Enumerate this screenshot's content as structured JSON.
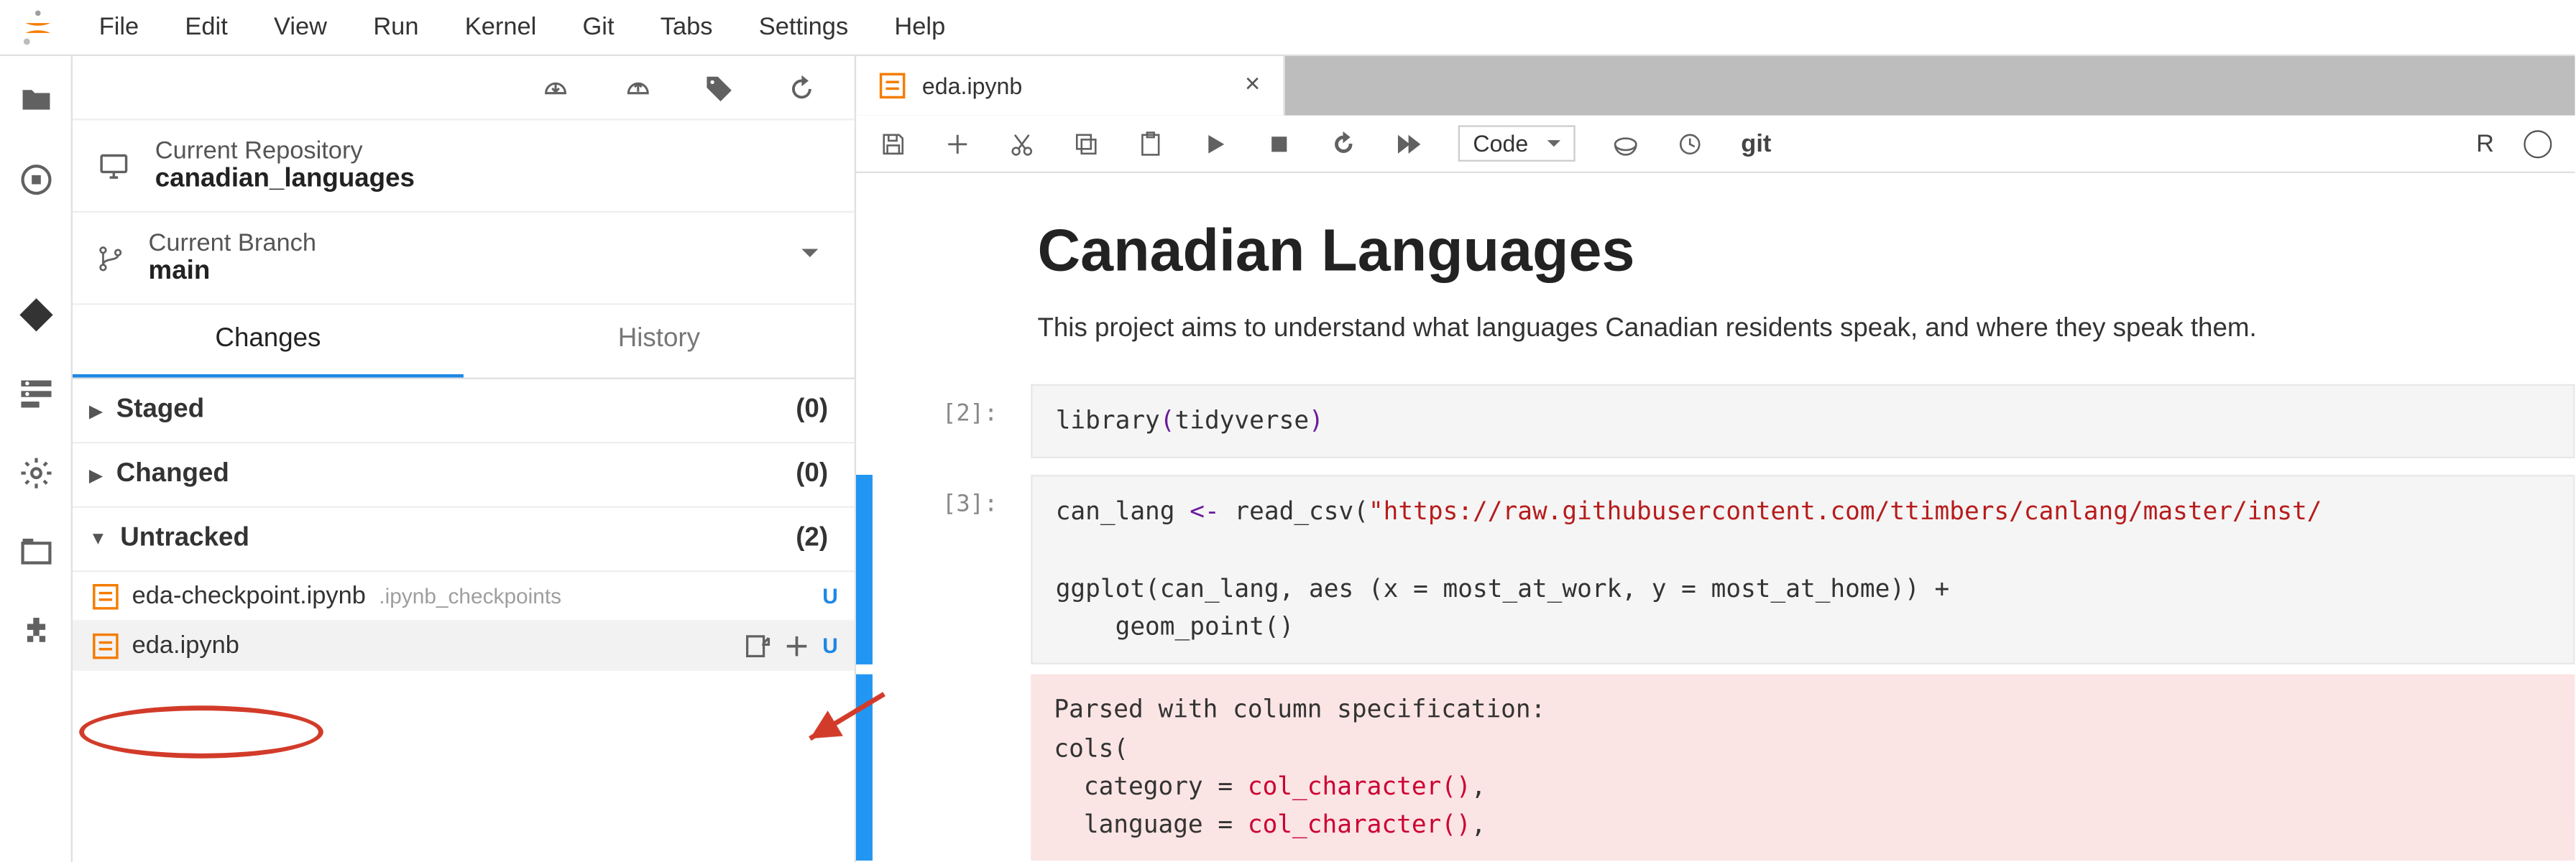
{
  "menu": {
    "items": [
      "File",
      "Edit",
      "View",
      "Run",
      "Kernel",
      "Git",
      "Tabs",
      "Settings",
      "Help"
    ]
  },
  "activity": {
    "icons": [
      "folder",
      "running",
      "git",
      "commands",
      "settings",
      "tabs",
      "extensions"
    ]
  },
  "git_panel": {
    "toolbar_icons": [
      "cloud-down",
      "cloud-up",
      "tag",
      "refresh"
    ],
    "repo_label": "Current Repository",
    "repo_name": "canadian_languages",
    "branch_label": "Current Branch",
    "branch_name": "main",
    "tabs": {
      "changes": "Changes",
      "history": "History",
      "active": "changes"
    },
    "sections": {
      "staged": {
        "label": "Staged",
        "count": "(0)",
        "open": false
      },
      "changed": {
        "label": "Changed",
        "count": "(0)",
        "open": false
      },
      "untracked": {
        "label": "Untracked",
        "count": "(2)",
        "open": true
      }
    },
    "untracked_files": [
      {
        "name": "eda-checkpoint.ipynb",
        "path": ".ipynb_checkpoints",
        "status": "U"
      },
      {
        "name": "eda.ipynb",
        "path": "",
        "status": "U",
        "hover": true
      }
    ]
  },
  "editor": {
    "tab": {
      "title": "eda.ipynb"
    },
    "toolbar": {
      "cell_type": "Code",
      "git_label": "git",
      "kernel_short": "R"
    },
    "markdown": {
      "title": "Canadian Languages",
      "body": "This project aims to understand what languages Canadian residents speak, and where they speak them."
    },
    "cells": [
      {
        "prompt": "[2]:",
        "code_html": "library<span class='tok-op'>(</span>tidyverse<span class='tok-op'>)</span>"
      },
      {
        "prompt": "[3]:",
        "code_html": "can_lang <span class='tok-op'>&lt;-</span> read_csv(<span class='tok-str'>\"https://raw.githubusercontent.com/ttimbers/canlang/master/inst/</span>\n\nggplot(can_lang, aes (x = most_at_work, y = most_at_home)) +\n    geom_point()"
      }
    ],
    "output_lines": [
      "Parsed with column specification:",
      "cols(",
      "  category = <span class='tok-out-red'>col_character()</span>,",
      "  language = <span class='tok-out-red'>col_character()</span>,"
    ]
  }
}
